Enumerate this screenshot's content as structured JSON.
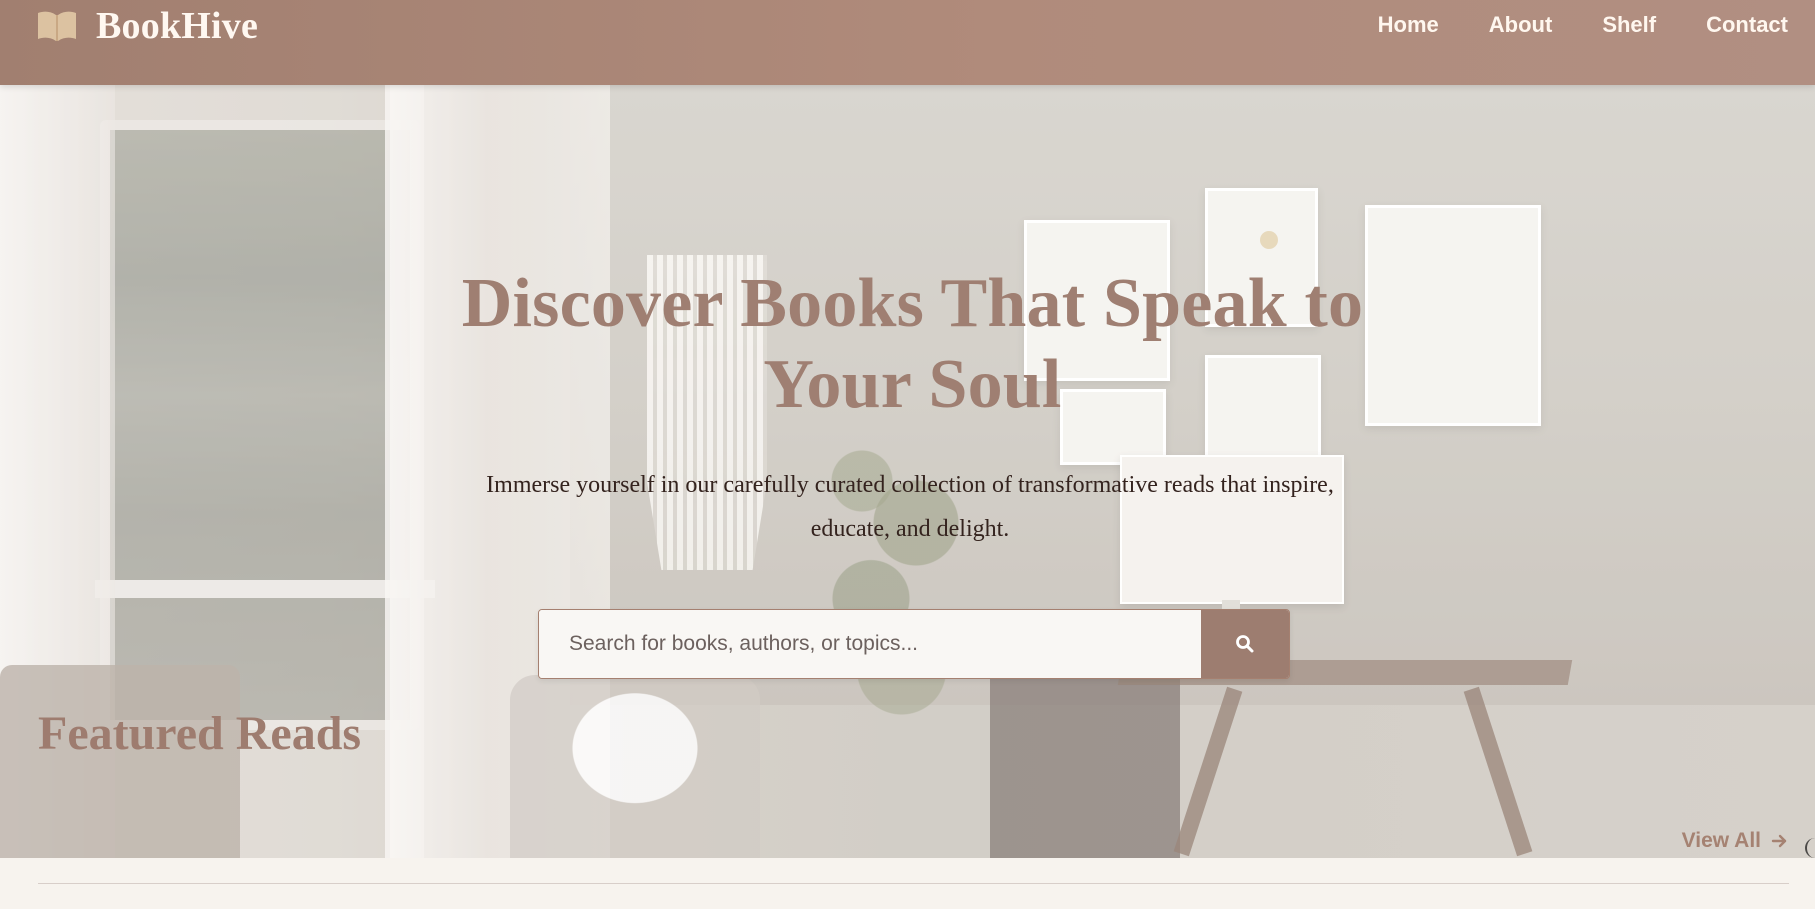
{
  "header": {
    "brand": "BookHive",
    "logo_icon": "book-icon",
    "nav": [
      {
        "label": "Home"
      },
      {
        "label": "About"
      },
      {
        "label": "Shelf"
      },
      {
        "label": "Contact"
      }
    ]
  },
  "hero": {
    "title": "Discover Books That Speak to Your Soul",
    "subtitle": "Immerse yourself in our carefully curated collection of transformative reads that inspire, educate, and delight.",
    "search": {
      "placeholder": "Search for books, authors, or topics...",
      "icon": "search-icon"
    }
  },
  "featured": {
    "title": "Featured Reads",
    "view_all": "View All",
    "arrow_icon": "arrow-right-icon"
  },
  "colors": {
    "header": "#a9887a",
    "accent": "#9e7c6f",
    "text_dark": "#34231e",
    "background": "#f7f3ee"
  }
}
